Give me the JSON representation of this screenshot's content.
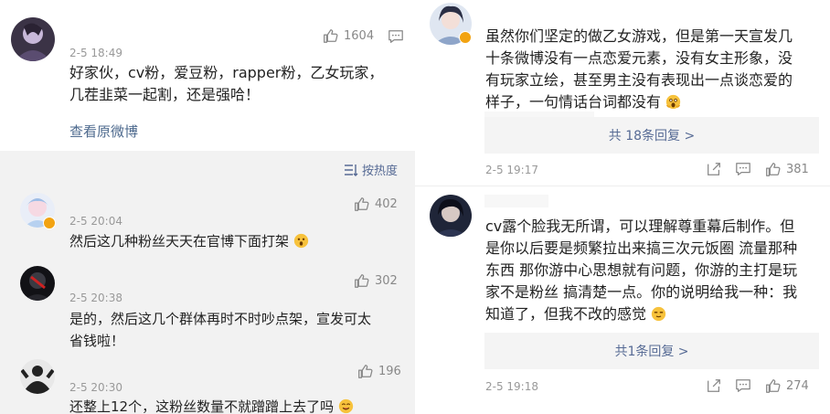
{
  "left": {
    "main_post": {
      "time": "2-5 18:49",
      "likes": "1604",
      "text_line1": "好家伙，cv粉，爱豆粉，rapper粉，乙女玩家，",
      "text_line2": "几茬韭菜一起割，还是强哈！",
      "link": "查看原微博"
    },
    "sort_label": "按热度",
    "replies": [
      {
        "time": "2-5 20:04",
        "likes": "402",
        "lines": [
          "然后这几种粉丝天天在官博下面打架"
        ],
        "emoji": "shock-face"
      },
      {
        "time": "2-5 20:38",
        "likes": "302",
        "lines": [
          "是的，然后这几个群体再时不时吵点架，宣发可太",
          "省钱啦！"
        ],
        "emoji": ""
      },
      {
        "time": "2-5 20:30",
        "likes": "196",
        "lines": [
          "还整上12个，这粉丝数量不就蹭蹭上去了吗"
        ],
        "emoji": "cheeky-face"
      }
    ]
  },
  "right": {
    "comment1": {
      "lines": [
        "虽然你们坚定的做乙女游戏，但是第一天宣发几",
        "十条微博没有一点恋爱元素，没有女主形象，没",
        "有玩家立绘，甚至男主没有表现出一点谈恋爱的",
        "样子，一句情话台词都没有"
      ],
      "emoji": "scared-face",
      "reply_count": "共 18条回复 >",
      "time": "2-5 19:17",
      "likes": "381"
    },
    "comment2": {
      "lines": [
        "cv露个脸我无所谓，可以理解尊重幕后制作。但",
        "是你以后要是频繁拉出来搞三次元饭圈 流量那种",
        "东西 那你游中心思想就有问题，你游的主打是玩",
        "家不是粉丝 搞清楚一点。你的说明给我一种：我",
        "知道了，但我不改的感觉"
      ],
      "emoji": "smug-face",
      "reply_count": "共1条回复 >",
      "time": "2-5 19:18",
      "likes": "274"
    }
  },
  "colors": {
    "link": "#4e6a8e",
    "meta": "#999999",
    "emoji": "#f7c23c",
    "badge": "#f2a312"
  }
}
